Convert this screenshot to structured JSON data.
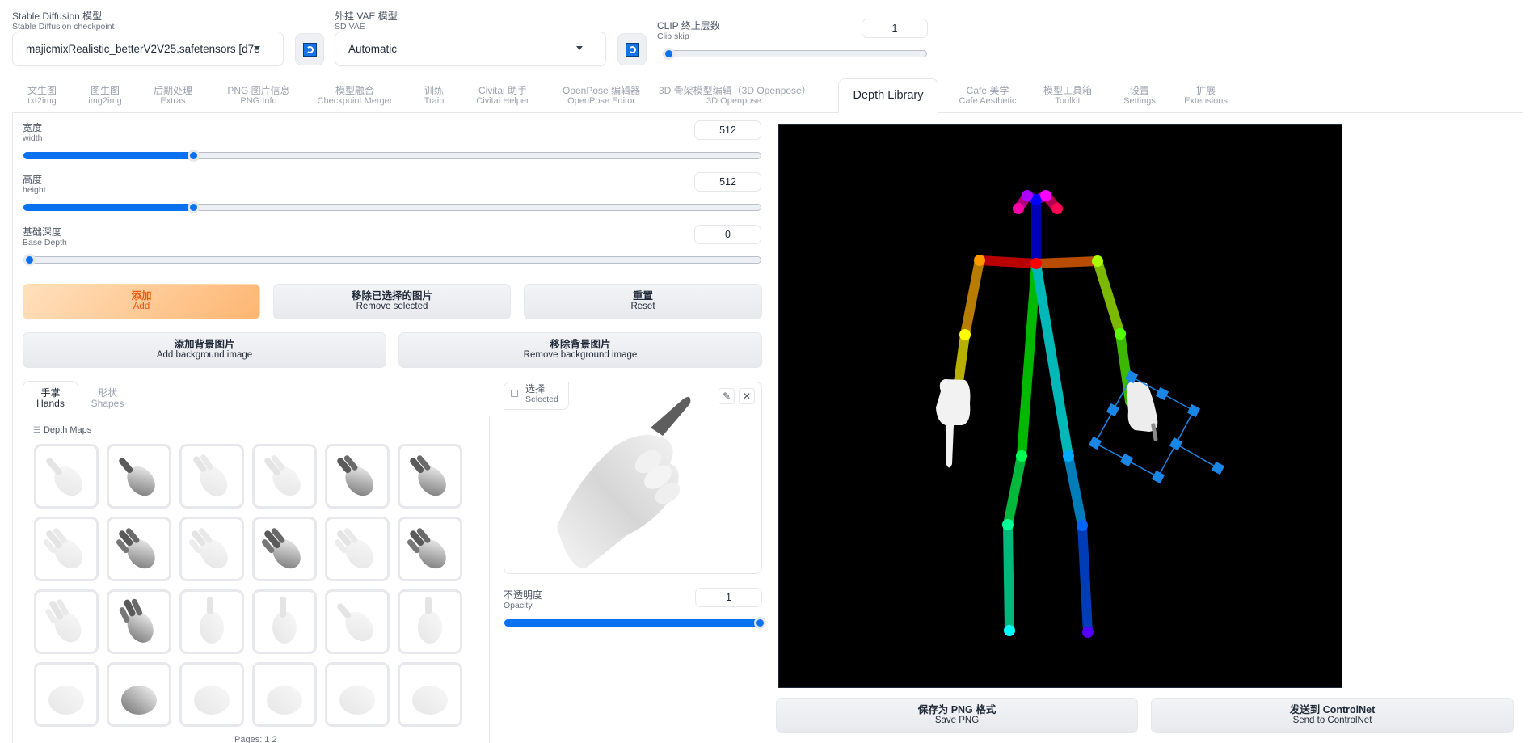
{
  "settings": {
    "checkpoint": {
      "label_cn": "Stable Diffusion 模型",
      "label_en": "Stable Diffusion checkpoint",
      "value": "majicmixRealistic_betterV2V25.safetensors [d7e"
    },
    "vae": {
      "label_cn": "外挂 VAE 模型",
      "label_en": "SD VAE",
      "value": "Automatic"
    },
    "clip_skip": {
      "label_cn": "CLIP 终止层数",
      "label_en": "Clip skip",
      "value": "1",
      "fraction": 0.0
    },
    "refresh_icon": "refresh-icon"
  },
  "tabs": [
    {
      "cn": "文生图",
      "en": "txt2img"
    },
    {
      "cn": "图生图",
      "en": "img2img"
    },
    {
      "cn": "后期处理",
      "en": "Extras"
    },
    {
      "cn": "PNG 图片信息",
      "en": "PNG Info"
    },
    {
      "cn": "模型融合",
      "en": "Checkpoint Merger"
    },
    {
      "cn": "训练",
      "en": "Train"
    },
    {
      "cn": "Civitai 助手",
      "en": "Civitai Helper"
    },
    {
      "cn": "OpenPose 编辑器",
      "en": "OpenPose Editor"
    },
    {
      "cn": "3D 骨架模型编辑（3D Openpose）",
      "en": "3D Openpose"
    },
    {
      "cn": "Depth Library",
      "en": ""
    },
    {
      "cn": "Cafe 美学",
      "en": "Cafe Aesthetic"
    },
    {
      "cn": "模型工具箱",
      "en": "Toolkit"
    },
    {
      "cn": "设置",
      "en": "Settings"
    },
    {
      "cn": "扩展",
      "en": "Extensions"
    }
  ],
  "active_tab": "Depth Library",
  "controls": {
    "width": {
      "label_cn": "宽度",
      "label_en": "width",
      "value": "512",
      "fraction": 0.23
    },
    "height": {
      "label_cn": "高度",
      "label_en": "height",
      "value": "512",
      "fraction": 0.23
    },
    "base_depth": {
      "label_cn": "基础深度",
      "label_en": "Base Depth",
      "value": "0",
      "fraction": 0.0
    }
  },
  "buttons": {
    "add": {
      "cn": "添加",
      "en": "Add"
    },
    "remove_selected": {
      "cn": "移除已选择的图片",
      "en": "Remove selected"
    },
    "reset": {
      "cn": "重置",
      "en": "Reset"
    },
    "add_bg": {
      "cn": "添加背景图片",
      "en": "Add background image"
    },
    "remove_bg": {
      "cn": "移除背景图片",
      "en": "Remove background image"
    },
    "save_png": {
      "cn": "保存为 PNG 格式",
      "en": "Save PNG"
    },
    "send_controlnet": {
      "cn": "发送到 ControlNet",
      "en": "Send to ControlNet"
    }
  },
  "library": {
    "tabs": [
      {
        "cn": "手掌",
        "en": "Hands",
        "active": true
      },
      {
        "cn": "形状",
        "en": "Shapes",
        "active": false
      }
    ],
    "section_label": "Depth Maps",
    "section_icon": "list-icon",
    "thumbnails": [
      "hand-point-1",
      "hand-point-2",
      "hand-peace-1",
      "hand-peace-2",
      "hand-peace-3",
      "hand-peace-4",
      "hand-flat-1",
      "hand-three-1",
      "hand-three-2",
      "hand-three-3",
      "hand-four-1",
      "hand-four-2",
      "hand-open-1",
      "hand-open-2",
      "hand-curl-1",
      "hand-curl-2",
      "hand-point-3",
      "hand-fist-top",
      "hand-side",
      "hand-fist-up",
      "hand-fist-front",
      "hand-fist-side-1",
      "hand-fist-side-2",
      "hand-fist-back"
    ],
    "pages_label": "Pages: 1 2"
  },
  "selected": {
    "label_cn": "选择",
    "label_en": "Selected",
    "edit_icon": "pencil-icon",
    "close_icon": "close-icon",
    "opacity": {
      "label_cn": "不透明度",
      "label_en": "Opacity",
      "value": "1",
      "fraction": 1.0
    }
  },
  "pose": {
    "background": "#000000",
    "selection_color": "#1a86e6"
  }
}
